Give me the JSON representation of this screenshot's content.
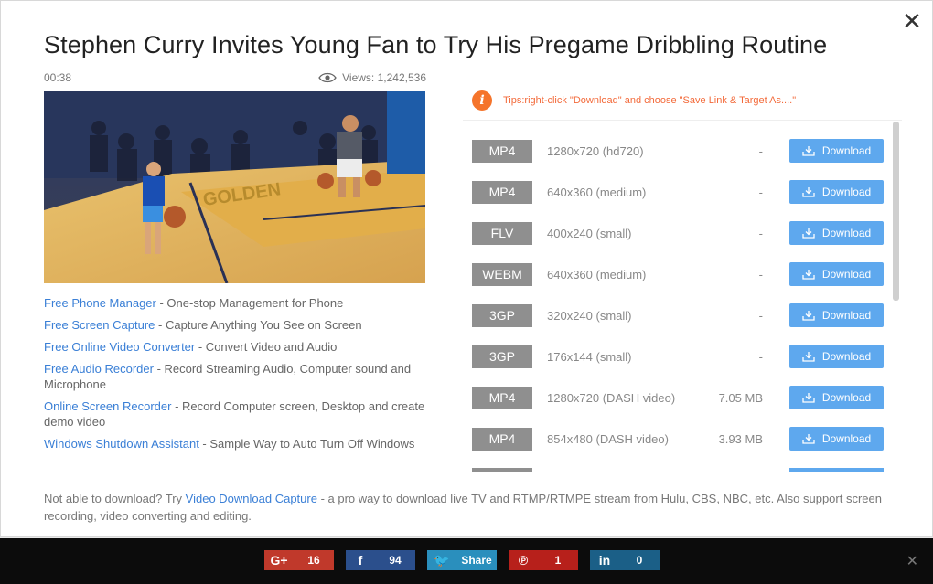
{
  "title": "Stephen Curry Invites Young Fan to Try His Pregame Dribbling Routine",
  "duration": "00:38",
  "views": "Views: 1,242,536",
  "close_label": "✕",
  "links": [
    {
      "link": "Free Phone Manager",
      "desc": " - One-stop Management for Phone"
    },
    {
      "link": "Free Screen Capture",
      "desc": " - Capture Anything You See on Screen"
    },
    {
      "link": "Free Online Video Converter",
      "desc": " - Convert Video and Audio"
    },
    {
      "link": "Free Audio Recorder",
      "desc": " - Record Streaming Audio, Computer sound and Microphone"
    },
    {
      "link": "Online Screen Recorder",
      "desc": " - Record Computer screen, Desktop and create demo video"
    },
    {
      "link": "Windows Shutdown Assistant",
      "desc": " - Sample Way to Auto Turn Off Windows"
    }
  ],
  "tip": {
    "icon": "i",
    "text": "Tips:right-click \"Download\" and choose \"Save Link & Target As....\""
  },
  "formats": [
    {
      "format": "MP4",
      "resolution": "1280x720 (hd720)",
      "size": "-",
      "button": "Download"
    },
    {
      "format": "MP4",
      "resolution": "640x360 (medium)",
      "size": "-",
      "button": "Download"
    },
    {
      "format": "FLV",
      "resolution": "400x240 (small)",
      "size": "-",
      "button": "Download"
    },
    {
      "format": "WEBM",
      "resolution": "640x360 (medium)",
      "size": "-",
      "button": "Download"
    },
    {
      "format": "3GP",
      "resolution": "320x240 (small)",
      "size": "-",
      "button": "Download"
    },
    {
      "format": "3GP",
      "resolution": "176x144 (small)",
      "size": "-",
      "button": "Download"
    },
    {
      "format": "MP4",
      "resolution": "1280x720 (DASH video)",
      "size": "7.05 MB",
      "button": "Download"
    },
    {
      "format": "MP4",
      "resolution": "854x480 (DASH video)",
      "size": "3.93 MB",
      "button": "Download"
    }
  ],
  "footer": {
    "prefix": "Not able to download? Try ",
    "link": "Video Download Capture",
    "suffix": " - a pro way to download live TV and RTMP/RTMPE stream from Hulu, CBS, NBC, etc. Also support screen recording, video converting and editing."
  },
  "share": [
    {
      "name": "googleplus",
      "glyph": "G+",
      "count": "16",
      "color": "#c0392b"
    },
    {
      "name": "facebook",
      "glyph": "f",
      "count": "94",
      "color": "#2b4f8c"
    },
    {
      "name": "twitter",
      "glyph": "🐦",
      "count": "Share",
      "color": "#2a8fbd"
    },
    {
      "name": "pinterest",
      "glyph": "℗",
      "count": "1",
      "color": "#b7201b"
    },
    {
      "name": "linkedin",
      "glyph": "in",
      "count": "0",
      "color": "#1b5f87"
    }
  ],
  "share_close": "✕",
  "colors": {
    "download_button": "#5ea8ee",
    "format_badge": "#8f8f8f",
    "link": "#3a7fd6",
    "tip": "#f36a3a"
  }
}
